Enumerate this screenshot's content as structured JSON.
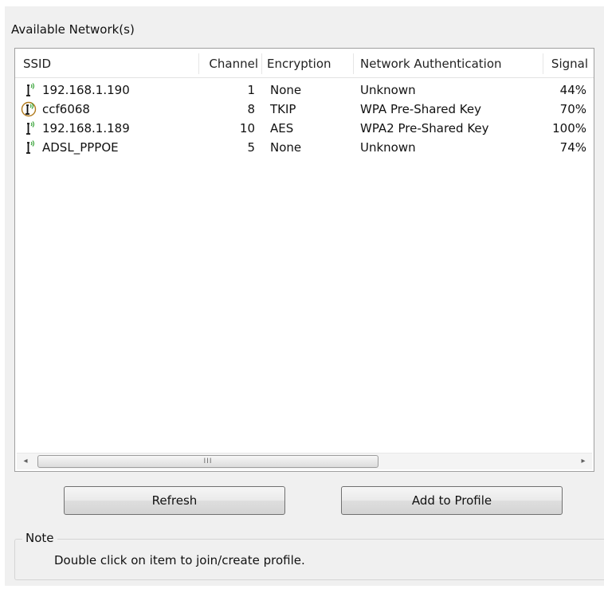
{
  "group_title": "Available Network(s)",
  "columns": {
    "ssid": "SSID",
    "channel": "Channel",
    "encryption": "Encryption",
    "auth": "Network Authentication",
    "signal": "Signal"
  },
  "networks": [
    {
      "ssid": "192.168.1.190",
      "channel": "1",
      "encryption": "None",
      "auth": "Unknown",
      "signal": "44%",
      "icon": "wifi-signal-icon",
      "connected": false
    },
    {
      "ssid": "ccf6068",
      "channel": "8",
      "encryption": "TKIP",
      "auth": "WPA Pre-Shared Key",
      "signal": "70%",
      "icon": "wifi-signal-connected-icon",
      "connected": true
    },
    {
      "ssid": "192.168.1.189",
      "channel": "10",
      "encryption": "AES",
      "auth": "WPA2 Pre-Shared Key",
      "signal": "100%",
      "icon": "wifi-signal-icon",
      "connected": false
    },
    {
      "ssid": "ADSL_PPPOE",
      "channel": "5",
      "encryption": "None",
      "auth": "Unknown",
      "signal": "74%",
      "icon": "wifi-signal-icon",
      "connected": false
    }
  ],
  "scrollbar": {
    "left_arrow": "◂",
    "right_arrow": "▸",
    "grip": "III"
  },
  "buttons": {
    "refresh": "Refresh",
    "add_to_profile": "Add to Profile"
  },
  "note": {
    "legend": "Note",
    "text": "Double click on item to join/create profile."
  },
  "colors": {
    "signal_waves": "#3aa43a",
    "connected_ring": "#b07a1c"
  }
}
